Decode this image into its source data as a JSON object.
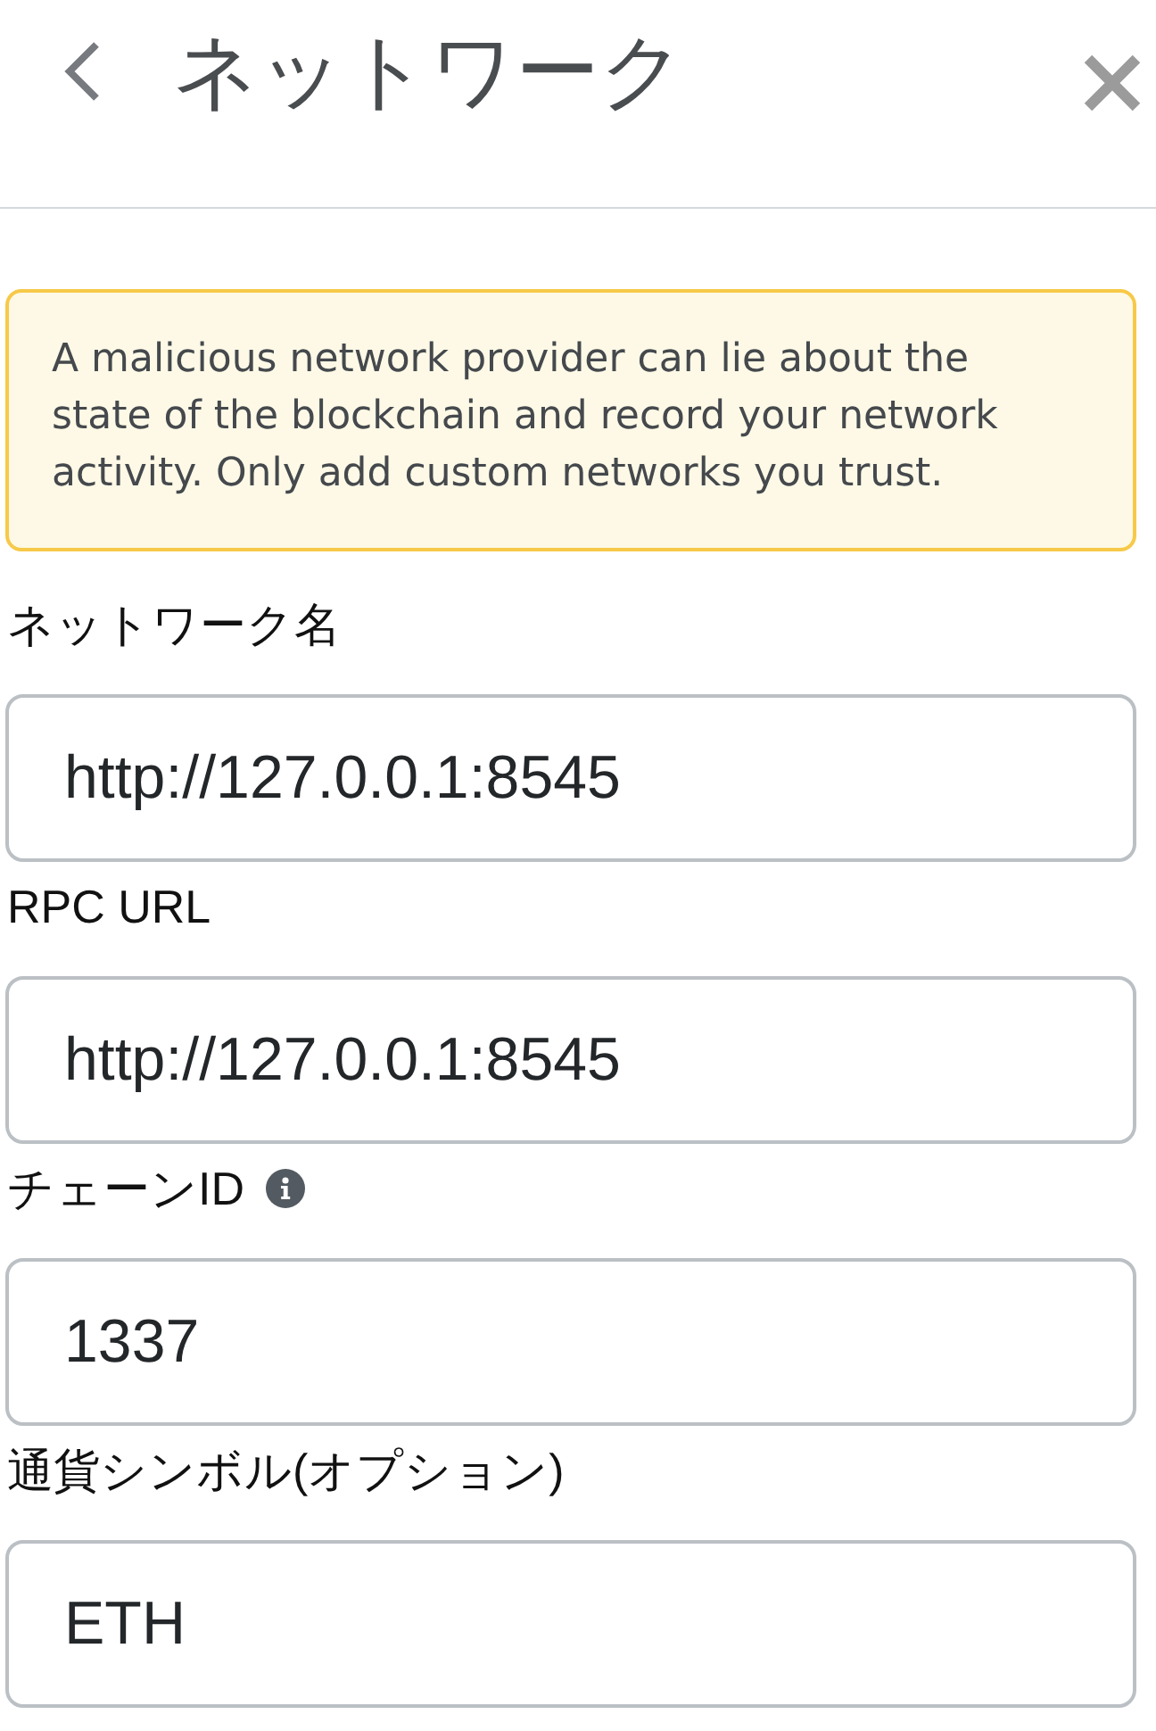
{
  "header": {
    "title": "ネットワーク"
  },
  "warning": {
    "text": "A malicious network provider can lie about the state of the blockchain and record your network activity. Only add custom networks you trust."
  },
  "fields": [
    {
      "label": "ネットワーク名",
      "value": "http://127.0.0.1:8545",
      "info": false
    },
    {
      "label": "RPC URL",
      "value": "http://127.0.0.1:8545",
      "info": false
    },
    {
      "label": "チェーンID",
      "value": "1337",
      "info": true
    },
    {
      "label": "通貨シンボル(オプション)",
      "value": "ETH",
      "info": false
    }
  ]
}
